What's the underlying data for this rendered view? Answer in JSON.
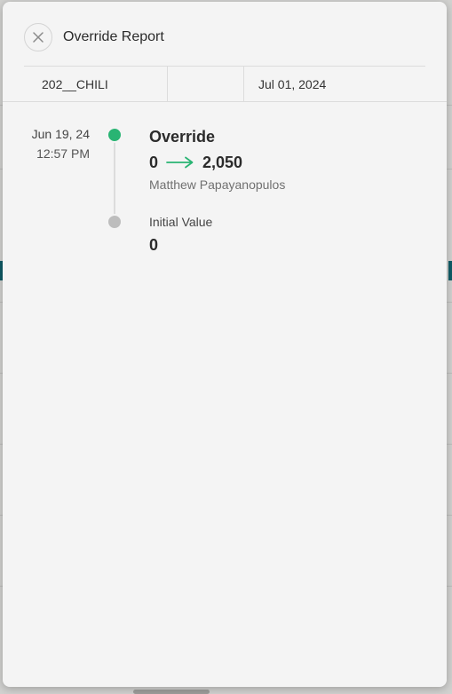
{
  "window": {
    "title": "Override Report"
  },
  "info": {
    "item": "202__CHILI",
    "middle": "",
    "date": "Jul 01, 2024"
  },
  "event": {
    "date": "Jun 19, 24",
    "time": "12:57 PM",
    "title": "Override",
    "from_value": "0",
    "to_value": "2,050",
    "user": "Matthew Papayanopulos"
  },
  "initial": {
    "label": "Initial Value",
    "value": "0"
  },
  "icons": {
    "close": "close-icon",
    "arrow": "arrow-right-icon"
  },
  "colors": {
    "accent_green": "#29b473",
    "dot_grey": "#bdbdbd",
    "panel_bg": "#f4f4f4"
  }
}
